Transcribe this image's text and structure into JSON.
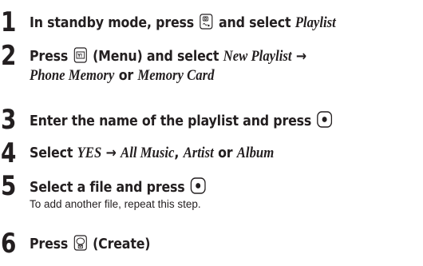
{
  "steps": [
    {
      "number": "1",
      "text1": "In standby mode, press",
      "icon": "camera-music-key-icon",
      "text2": "and select",
      "italic1": "Playlist"
    },
    {
      "number": "2",
      "text1": "Press",
      "icon": "menu-key-icon",
      "text2": "(Menu) and select",
      "italic1": "New Playlist",
      "arrow": "→",
      "italic2": "Phone Memory",
      "connector": "or",
      "italic3": "Memory Card"
    },
    {
      "number": "3",
      "text1": "Enter the name of the playlist and press",
      "icon": "center-key-icon"
    },
    {
      "number": "4",
      "text1": "Select",
      "italic1": "YES",
      "arrow": "→",
      "italic2": "All Music",
      "comma": ",",
      "italic3": "Artist",
      "connector": "or",
      "italic4": "Album"
    },
    {
      "number": "5",
      "text1": "Select a file and press",
      "icon": "center-key-icon",
      "note": "To add another file, repeat this step."
    },
    {
      "number": "6",
      "text1": "Press",
      "icon": "mail-key-icon",
      "text2": "(Create)"
    }
  ]
}
